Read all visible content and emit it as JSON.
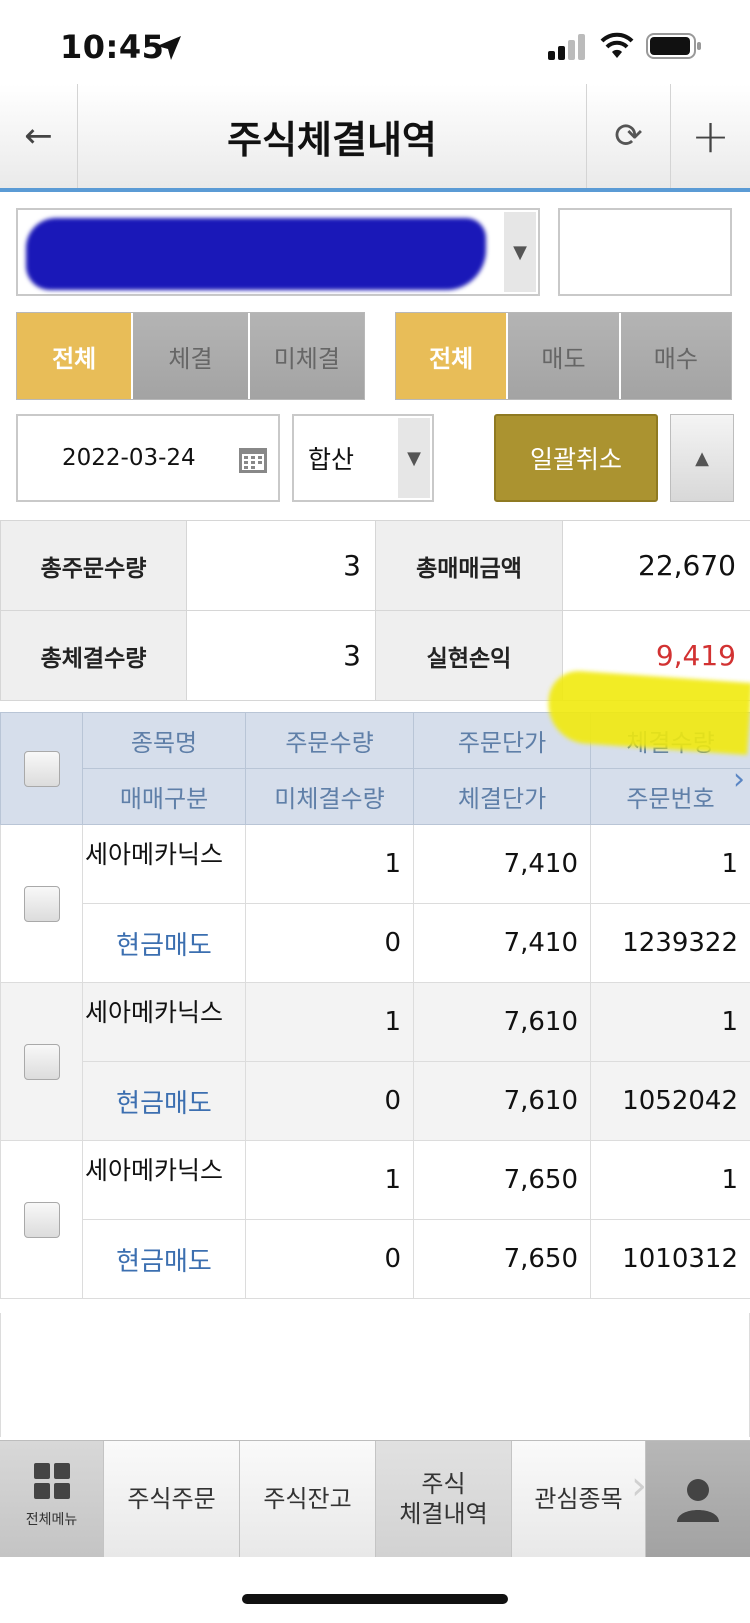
{
  "status_bar": {
    "time": "10:45"
  },
  "header": {
    "title": "주식체결내역"
  },
  "filters": {
    "exec": [
      "전체",
      "체결",
      "미체결"
    ],
    "side": [
      "전체",
      "매도",
      "매수"
    ],
    "date": "2022-03-24",
    "aggregate": "합산",
    "cancel_all": "일괄취소"
  },
  "summary": {
    "total_order_qty_label": "총주문수량",
    "total_order_qty": "3",
    "total_trade_amount_label": "총매매금액",
    "total_trade_amount": "22,670",
    "total_exec_qty_label": "총체결수량",
    "total_exec_qty": "3",
    "realized_pl_label": "실현손익",
    "realized_pl": "9,419",
    "colors": {
      "profit": "#d23232"
    }
  },
  "grid": {
    "headers_top": [
      "종목명",
      "주문수량",
      "주문단가",
      "체결수량"
    ],
    "headers_bottom": [
      "매매구분",
      "미체결수량",
      "체결단가",
      "주문번호"
    ],
    "rows": [
      {
        "name": "세아메카닉스",
        "order_qty": "1",
        "order_price": "7,410",
        "exec_qty": "1",
        "type": "현금매도",
        "unexec_qty": "0",
        "exec_price": "7,410",
        "order_no": "1239322"
      },
      {
        "name": "세아메카닉스",
        "order_qty": "1",
        "order_price": "7,610",
        "exec_qty": "1",
        "type": "현금매도",
        "unexec_qty": "0",
        "exec_price": "7,610",
        "order_no": "1052042"
      },
      {
        "name": "세아메카닉스",
        "order_qty": "1",
        "order_price": "7,650",
        "exec_qty": "1",
        "type": "현금매도",
        "unexec_qty": "0",
        "exec_price": "7,650",
        "order_no": "1010312"
      }
    ]
  },
  "tabbar": {
    "menu": "전체메뉴",
    "order": "주식주문",
    "balance": "주식잔고",
    "history_line1": "주식",
    "history_line2": "체결내역",
    "watch": "관심종목"
  },
  "icons": {
    "back": "back-arrow-icon",
    "refresh": "refresh-icon",
    "add": "plus-icon",
    "calendar": "calendar-icon",
    "user": "user-icon"
  },
  "colors": {
    "accent": "#5b9bd5",
    "active_tab": "#e8bd58",
    "cancel_button": "#ab9330",
    "type_text": "#3c6fb0"
  }
}
